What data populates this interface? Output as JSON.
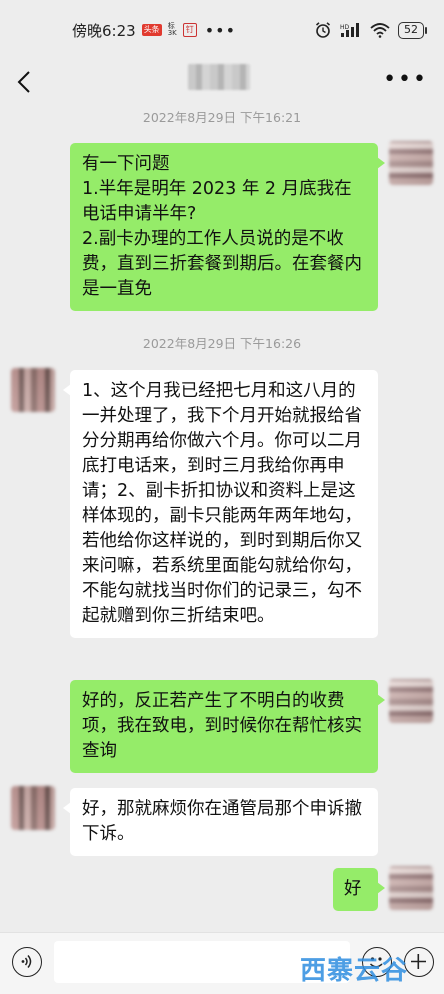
{
  "status_bar": {
    "time": "傍晚6:23",
    "app_icons": [
      "头条",
      "标\n3K",
      "钉"
    ],
    "battery": "52"
  },
  "nav": {
    "contact_name": ""
  },
  "messages": [
    {
      "type": "timestamp",
      "text": "2022年8月29日  下午16:21"
    },
    {
      "type": "sent",
      "text": "有一下问题\n1.半年是明年 2023 年 2 月底我在电话申请半年?\n2.副卡办理的工作人员说的是不收费，直到三折套餐到期后。在套餐内是一直免"
    },
    {
      "type": "timestamp",
      "text": "2022年8月29日  下午16:26"
    },
    {
      "type": "received",
      "text": "1、这个月我已经把七月和这八月的一并处理了，我下个月开始就报给省分分期再给你做六个月。你可以二月底打电话来，到时三月我给你再申请；2、副卡折扣协议和资料上是这样体现的，副卡只能两年两年地勾，若他给你这样说的，到时到期后你又来问嘛，若系统里面能勾就给你勾，不能勾就找当时你们的记录三，勾不起就赠到你三折结束吧。"
    },
    {
      "type": "sent",
      "text": "好的，反正若产生了不明白的收费项，我在致电，到时候你在帮忙核实查询"
    },
    {
      "type": "received",
      "text": "好，那就麻烦你在通管局那个申诉撤下诉。"
    },
    {
      "type": "sent",
      "text": "好"
    }
  ],
  "input": {
    "value": ""
  },
  "watermark": "西寨云谷",
  "colors": {
    "sent_bubble": "#95ec69",
    "received_bubble": "#ffffff",
    "background": "#ededed"
  },
  "icons": [
    "back-arrow-icon",
    "more-dots-icon",
    "voice-icon",
    "emoji-icon",
    "plus-icon",
    "alarm-icon",
    "hd-signal-icon",
    "wifi-icon",
    "battery-icon"
  ]
}
